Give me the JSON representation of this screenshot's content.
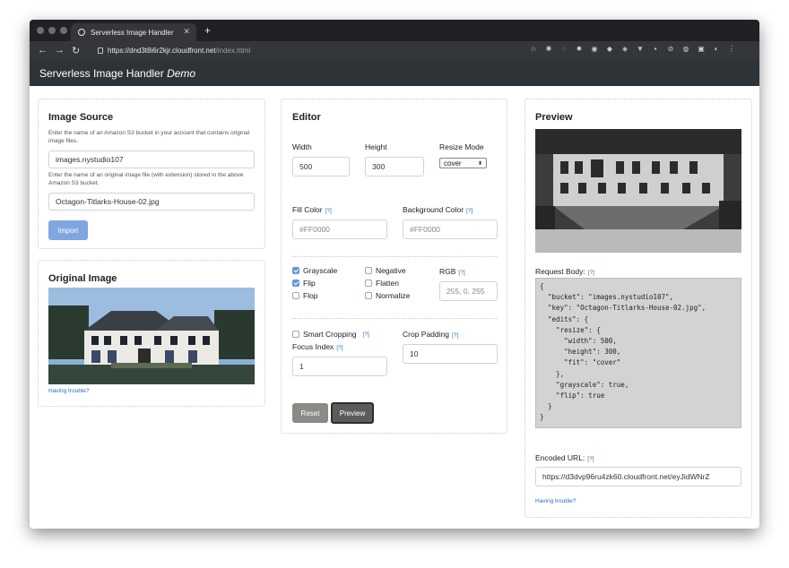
{
  "browser": {
    "tab_title": "Serverless Image Handler",
    "url_host": "https://dnd3t8i6r2kjr.cloudfront.net",
    "url_path": "/index.html"
  },
  "app": {
    "title": "Serverless Image Handler",
    "title_suffix": "Demo"
  },
  "image_source": {
    "heading": "Image Source",
    "bucket_help": "Enter the name of an Amazon S3 bucket in your account that contains original image files.",
    "bucket_value": "images.nystudio107",
    "key_help": "Enter the name of an original image file (with extension) stored in the above Amazon S3 bucket.",
    "key_value": "Octagon-Titlarks-House-02.jpg",
    "import_label": "Import"
  },
  "original": {
    "heading": "Original Image",
    "trouble_link": "Having trouble?"
  },
  "editor": {
    "heading": "Editor",
    "width_label": "Width",
    "width_value": "500",
    "height_label": "Height",
    "height_value": "300",
    "resize_label": "Resize Mode",
    "resize_value": "cover",
    "fill_label": "Fill Color",
    "fill_placeholder": "#FF0000",
    "bg_label": "Background Color",
    "bg_placeholder": "#FF0000",
    "help": "[?]",
    "checks": {
      "grayscale": "Grayscale",
      "flip": "Flip",
      "flop": "Flop",
      "negative": "Negative",
      "flatten": "Flatten",
      "normalize": "Normalize"
    },
    "rgb_label": "RGB",
    "rgb_placeholder": "255, 0, 255",
    "smart_label": "Smart Cropping",
    "focus_label": "Focus Index",
    "focus_value": "1",
    "padding_label": "Crop Padding",
    "padding_value": "10",
    "reset_label": "Reset",
    "preview_label": "Preview"
  },
  "preview": {
    "heading": "Preview",
    "request_label": "Request Body:",
    "request_body": "{\n  \"bucket\": \"images.nystudio107\",\n  \"key\": \"Octagon-Titlarks-House-02.jpg\",\n  \"edits\": {\n    \"resize\": {\n      \"width\": 500,\n      \"height\": 300,\n      \"fit\": \"cover\"\n    },\n    \"grayscale\": true,\n    \"flip\": true\n  }\n}",
    "encoded_label": "Encoded URL:",
    "encoded_value": "https://d3dvp96ru4zk60.cloudfront.net/eyJidWNrZ",
    "trouble_link": "Having trouble?"
  }
}
